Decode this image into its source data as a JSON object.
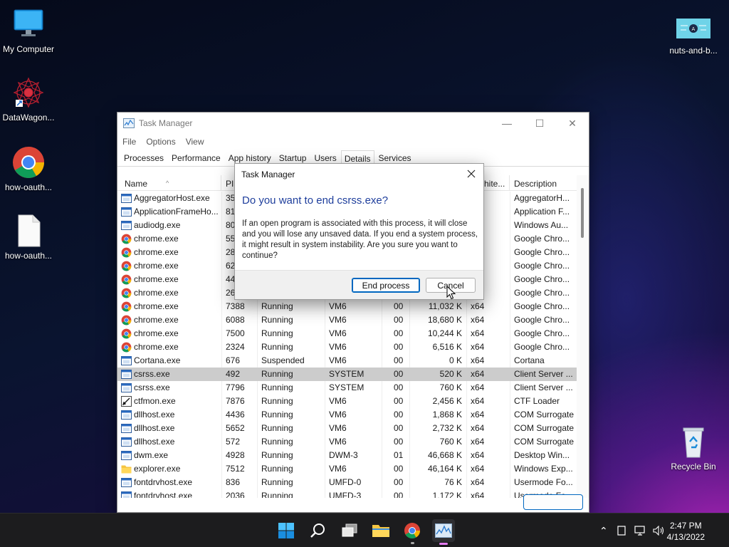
{
  "desktop": {
    "icons": [
      {
        "label": "My Computer"
      },
      {
        "label": "DataWagon..."
      },
      {
        "label": "how-oauth..."
      },
      {
        "label": "how-oauth..."
      },
      {
        "label": "nuts-and-b..."
      },
      {
        "label": "Recycle Bin"
      }
    ]
  },
  "task_manager": {
    "title": "Task Manager",
    "menu": [
      "File",
      "Options",
      "View"
    ],
    "tabs": [
      "Processes",
      "Performance",
      "App history",
      "Startup",
      "Users",
      "Details",
      "Services"
    ],
    "active_tab": "Details",
    "columns": {
      "name": "Name",
      "pid": "PID",
      "user_fragment": "hite...",
      "description": "Description"
    },
    "rows": [
      {
        "name": "AggregatorHost.exe",
        "pid": "35",
        "status": "",
        "user": "",
        "cpu": "",
        "mem": "",
        "arch": "",
        "desc": "AggregatorH...",
        "icon": "window-icon"
      },
      {
        "name": "ApplicationFrameHo...",
        "pid": "81",
        "status": "",
        "user": "",
        "cpu": "",
        "mem": "",
        "arch": "",
        "desc": "Application F...",
        "icon": "window-icon"
      },
      {
        "name": "audiodg.exe",
        "pid": "80",
        "status": "",
        "user": "",
        "cpu": "",
        "mem": "",
        "arch": "",
        "desc": "Windows Au...",
        "icon": "window-icon"
      },
      {
        "name": "chrome.exe",
        "pid": "55",
        "status": "",
        "user": "",
        "cpu": "",
        "mem": "",
        "arch": "",
        "desc": "Google Chro...",
        "icon": "chrome-icon"
      },
      {
        "name": "chrome.exe",
        "pid": "28",
        "status": "",
        "user": "",
        "cpu": "",
        "mem": "",
        "arch": "",
        "desc": "Google Chro...",
        "icon": "chrome-icon"
      },
      {
        "name": "chrome.exe",
        "pid": "62",
        "status": "",
        "user": "",
        "cpu": "",
        "mem": "",
        "arch": "",
        "desc": "Google Chro...",
        "icon": "chrome-icon"
      },
      {
        "name": "chrome.exe",
        "pid": "44",
        "status": "",
        "user": "",
        "cpu": "",
        "mem": "",
        "arch": "",
        "desc": "Google Chro...",
        "icon": "chrome-icon"
      },
      {
        "name": "chrome.exe",
        "pid": "26",
        "status": "",
        "user": "",
        "cpu": "",
        "mem": "",
        "arch": "",
        "desc": "Google Chro...",
        "icon": "chrome-icon"
      },
      {
        "name": "chrome.exe",
        "pid": "7388",
        "status": "Running",
        "user": "VM6",
        "cpu": "00",
        "mem": "11,032 K",
        "arch": "x64",
        "desc": "Google Chro...",
        "icon": "chrome-icon"
      },
      {
        "name": "chrome.exe",
        "pid": "6088",
        "status": "Running",
        "user": "VM6",
        "cpu": "00",
        "mem": "18,680 K",
        "arch": "x64",
        "desc": "Google Chro...",
        "icon": "chrome-icon"
      },
      {
        "name": "chrome.exe",
        "pid": "7500",
        "status": "Running",
        "user": "VM6",
        "cpu": "00",
        "mem": "10,244 K",
        "arch": "x64",
        "desc": "Google Chro...",
        "icon": "chrome-icon"
      },
      {
        "name": "chrome.exe",
        "pid": "2324",
        "status": "Running",
        "user": "VM6",
        "cpu": "00",
        "mem": "6,516 K",
        "arch": "x64",
        "desc": "Google Chro...",
        "icon": "chrome-icon"
      },
      {
        "name": "Cortana.exe",
        "pid": "676",
        "status": "Suspended",
        "user": "VM6",
        "cpu": "00",
        "mem": "0 K",
        "arch": "x64",
        "desc": "Cortana",
        "icon": "window-icon"
      },
      {
        "name": "csrss.exe",
        "pid": "492",
        "status": "Running",
        "user": "SYSTEM",
        "cpu": "00",
        "mem": "520 K",
        "arch": "x64",
        "desc": "Client Server ...",
        "icon": "window-icon",
        "selected": true
      },
      {
        "name": "csrss.exe",
        "pid": "7796",
        "status": "Running",
        "user": "SYSTEM",
        "cpu": "00",
        "mem": "760 K",
        "arch": "x64",
        "desc": "Client Server ...",
        "icon": "window-icon"
      },
      {
        "name": "ctfmon.exe",
        "pid": "7876",
        "status": "Running",
        "user": "VM6",
        "cpu": "00",
        "mem": "2,456 K",
        "arch": "x64",
        "desc": "CTF Loader",
        "icon": "pen-icon"
      },
      {
        "name": "dllhost.exe",
        "pid": "4436",
        "status": "Running",
        "user": "VM6",
        "cpu": "00",
        "mem": "1,868 K",
        "arch": "x64",
        "desc": "COM Surrogate",
        "icon": "window-icon"
      },
      {
        "name": "dllhost.exe",
        "pid": "5652",
        "status": "Running",
        "user": "VM6",
        "cpu": "00",
        "mem": "2,732 K",
        "arch": "x64",
        "desc": "COM Surrogate",
        "icon": "window-icon"
      },
      {
        "name": "dllhost.exe",
        "pid": "572",
        "status": "Running",
        "user": "VM6",
        "cpu": "00",
        "mem": "760 K",
        "arch": "x64",
        "desc": "COM Surrogate",
        "icon": "window-icon"
      },
      {
        "name": "dwm.exe",
        "pid": "4928",
        "status": "Running",
        "user": "DWM-3",
        "cpu": "01",
        "mem": "46,668 K",
        "arch": "x64",
        "desc": "Desktop Win...",
        "icon": "window-icon"
      },
      {
        "name": "explorer.exe",
        "pid": "7512",
        "status": "Running",
        "user": "VM6",
        "cpu": "00",
        "mem": "46,164 K",
        "arch": "x64",
        "desc": "Windows Exp...",
        "icon": "folder-icon"
      },
      {
        "name": "fontdrvhost.exe",
        "pid": "836",
        "status": "Running",
        "user": "UMFD-0",
        "cpu": "00",
        "mem": "76 K",
        "arch": "x64",
        "desc": "Usermode Fo...",
        "icon": "window-icon"
      },
      {
        "name": "fontdrvhost.exe",
        "pid": "2036",
        "status": "Running",
        "user": "UMFD-3",
        "cpu": "00",
        "mem": "1,172 K",
        "arch": "x64",
        "desc": "Usermode Fo...",
        "icon": "window-icon"
      }
    ]
  },
  "dialog": {
    "title": "Task Manager",
    "heading": "Do you want to end csrss.exe?",
    "message": "If an open program is associated with this process, it will close and you will lose any unsaved data. If you end a system process, it might result in system instability. Are you sure you want to continue?",
    "primary_label": "End process",
    "cancel_label": "Cancel"
  },
  "taskbar": {
    "time": "2:47 PM",
    "date": "4/13/2022"
  },
  "colors": {
    "accent": "#0067c0",
    "dialog_heading": "#1e3e9c",
    "selected_row": "#cccccc",
    "taskbar": "#1c1c1e"
  }
}
